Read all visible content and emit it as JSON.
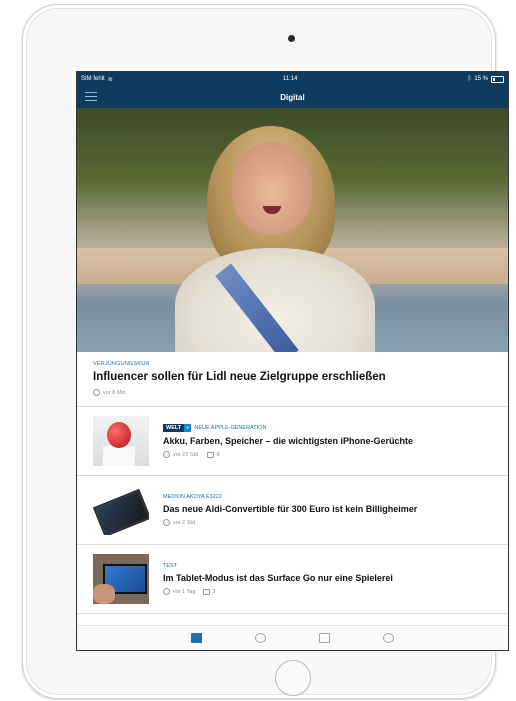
{
  "status_bar": {
    "carrier": "SIM fehlt",
    "time": "11:14",
    "battery": "15 %"
  },
  "nav": {
    "title": "Digital",
    "menu_icon": "hamburger-list-icon"
  },
  "feature": {
    "kicker": "VERJÜNGUNGSKUR",
    "title": "Influencer sollen für Lidl neue Zielgruppe erschließen",
    "time": "vor 8 Min."
  },
  "articles": [
    {
      "badge": "WELT",
      "badge_plus": "+",
      "kicker": "NEUE APPLE-GENERATION",
      "title": "Akku, Farben, Speicher – die wichtigsten iPhone-Gerüchte",
      "time": "vor 22 Std.",
      "comments": "6"
    },
    {
      "kicker": "MEDION AKOYA E3222",
      "title": "Das neue Aldi-Convertible für 300 Euro ist kein Billigheimer",
      "time": "vor 2 Std."
    },
    {
      "kicker": "TEST",
      "title": "Im Tablet-Modus ist das Surface Go nur eine Spielerei",
      "time": "vor 1 Tag",
      "comments": "3"
    }
  ],
  "tabs": [
    {
      "icon": "newspaper-icon",
      "active": true
    },
    {
      "icon": "clock-icon",
      "active": false
    },
    {
      "icon": "tv-icon",
      "active": false
    },
    {
      "icon": "person-icon",
      "active": false
    }
  ],
  "colors": {
    "brand": "#0f3b5e",
    "accent": "#1e6fa8"
  }
}
